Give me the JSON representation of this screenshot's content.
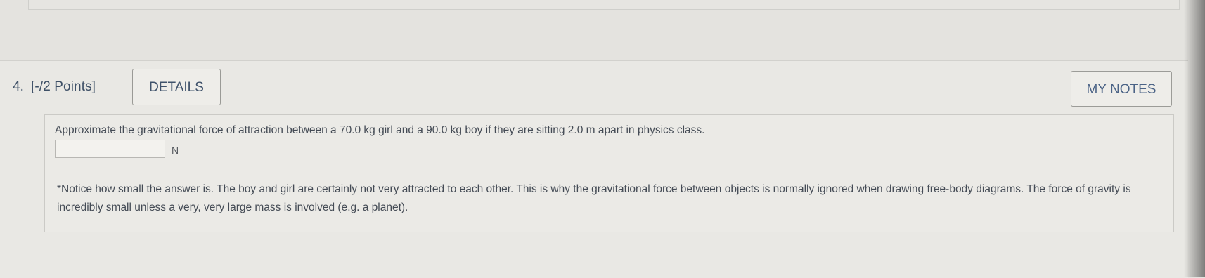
{
  "question": {
    "number": "4.",
    "points": "[-/2 Points]",
    "details_label": "DETAILS",
    "my_notes_label": "MY NOTES",
    "prompt": "Approximate the gravitational force of attraction between a 70.0 kg girl and a 90.0 kg boy if they are sitting 2.0 m apart in physics class.",
    "answer_value": "",
    "unit": "N",
    "notice": "*Notice how small the answer is. The boy and girl are certainly not very attracted to each other. This is why the gravitational force between objects is normally ignored when drawing free-body diagrams. The force of gravity is incredibly small unless a very, very large mass is involved (e.g. a planet)."
  }
}
